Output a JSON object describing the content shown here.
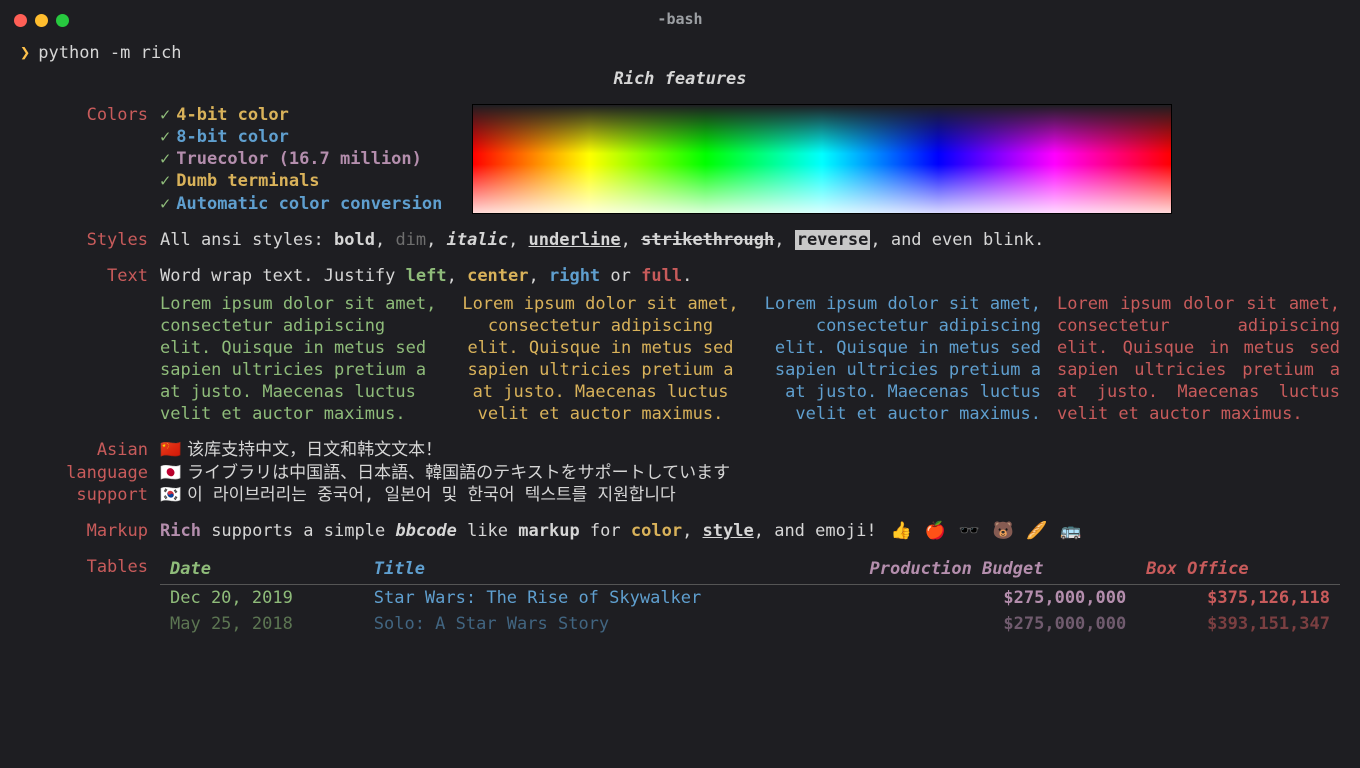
{
  "window": {
    "title": "-bash"
  },
  "prompt": {
    "symbol": "❯",
    "command": "python -m rich"
  },
  "heading": "Rich features",
  "labels": {
    "colors": "Colors",
    "styles": "Styles",
    "text": "Text",
    "asian": "Asian language support",
    "markup": "Markup",
    "tables": "Tables"
  },
  "colors": {
    "items": [
      {
        "check": "✓",
        "text": "4-bit color",
        "class": "c-yellow"
      },
      {
        "check": "✓",
        "text": "8-bit color",
        "class": "c-blue"
      },
      {
        "check": "✓",
        "text": "Truecolor (16.7 million)",
        "class": "c-purple"
      },
      {
        "check": "✓",
        "text": "Dumb terminals",
        "class": "c-yellow"
      },
      {
        "check": "✓",
        "text": "Automatic color conversion",
        "class": "c-blue"
      }
    ]
  },
  "styles": {
    "prefix": "All ansi styles: ",
    "bold": "bold",
    "dim": "dim",
    "italic": "italic",
    "underline": "underline",
    "strike": "strikethrough",
    "reverse": "reverse",
    "suffix": ", and even blink."
  },
  "text": {
    "line": "Word wrap text. Justify ",
    "left": "left",
    "center": "center",
    "right": "right",
    "or": " or ",
    "full": "full",
    "period": ".",
    "lorem": "Lorem ipsum dolor sit amet, consectetur adipiscing elit. Quisque in metus sed sapien ultricies pretium a at justo. Maecenas luctus velit et auctor maximus."
  },
  "asian": {
    "zh": {
      "flag": "🇨🇳",
      "text": "该库支持中文，日文和韩文文本！"
    },
    "ja": {
      "flag": "🇯🇵",
      "text": "ライブラリは中国語、日本語、韓国語のテキストをサポートしています"
    },
    "ko": {
      "flag": "🇰🇷",
      "text": "이 라이브러리는 중국어, 일본어 및 한국어 텍스트를 지원합니다"
    }
  },
  "markup": {
    "rich": "Rich",
    "mid1": " supports a simple ",
    "bbcode": "bbcode",
    "mid2": " like ",
    "markup_word": "markup",
    "mid3": " for ",
    "color": "color",
    "sep1": ", ",
    "style": "style",
    "mid4": ", and emoji! ",
    "emojis": "👍 🍎 🕶️ 🐻 🥖 🚌"
  },
  "table": {
    "headers": {
      "date": "Date",
      "title": "Title",
      "budget": "Production Budget",
      "box": "Box Office"
    },
    "rows": [
      {
        "date": "Dec 20, 2019",
        "title": "Star Wars: The Rise of Skywalker",
        "budget": "$275,000,000",
        "box": "$375,126,118",
        "dim": false
      },
      {
        "date": "May 25, 2018",
        "title": "Solo: A Star Wars Story",
        "budget": "$275,000,000",
        "box": "$393,151,347",
        "dim": true
      }
    ]
  }
}
